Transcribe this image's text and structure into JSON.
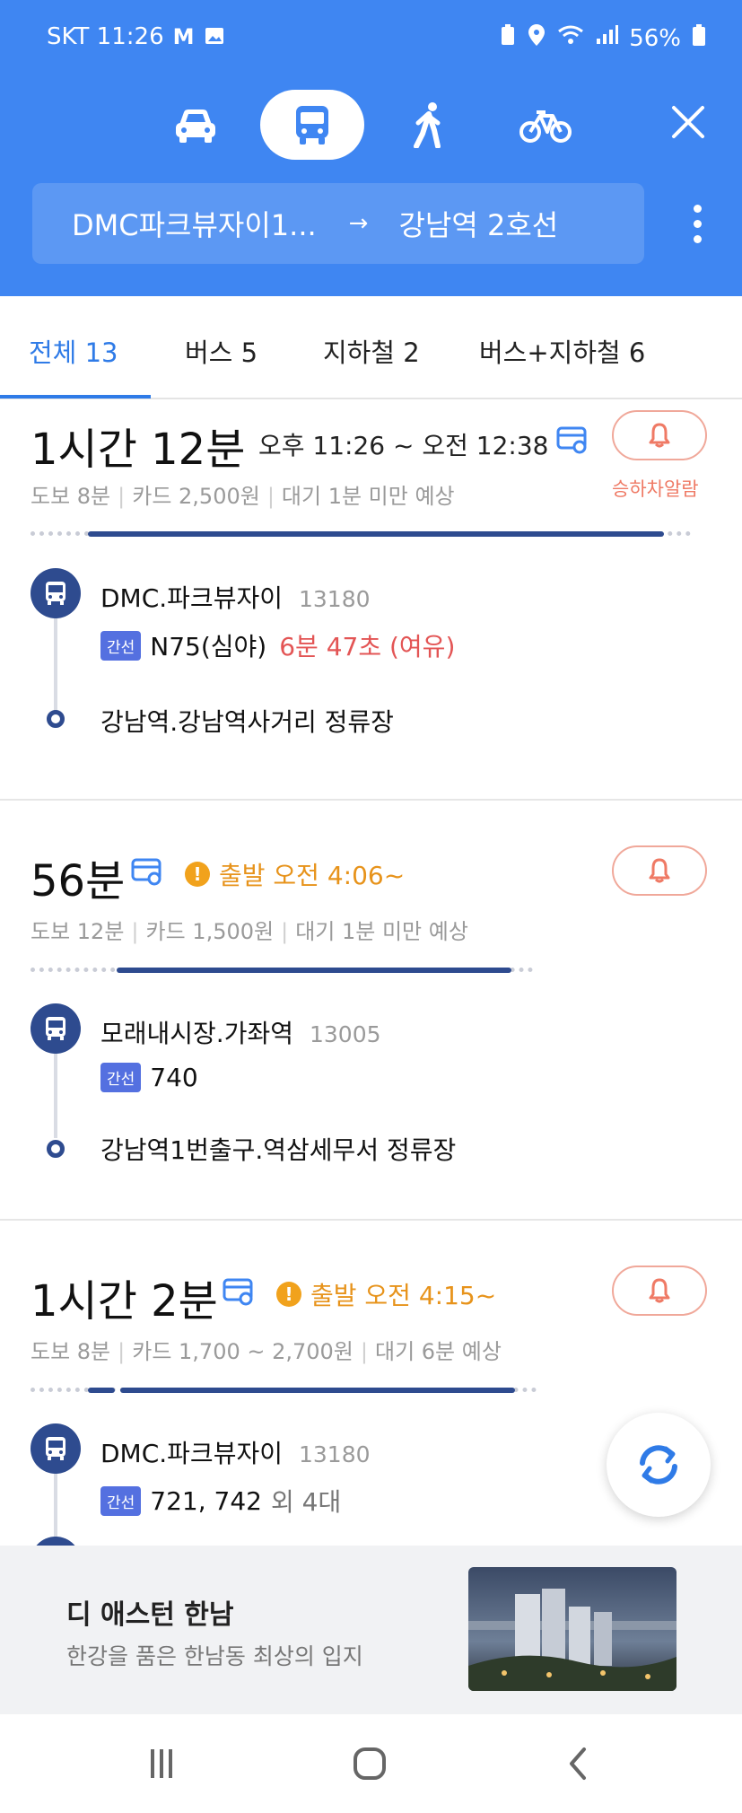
{
  "status_bar": {
    "carrier_time": "SKT 11:26",
    "battery": "56%"
  },
  "header": {
    "modes": [
      "car-icon",
      "bus-icon",
      "walk-icon",
      "bike-icon"
    ],
    "active_mode": "bus-icon",
    "route": {
      "from": "DMC파크뷰자이1...",
      "arrow": "→",
      "to": "강남역 2호선"
    }
  },
  "tabs": [
    {
      "label": "전체 13",
      "active": true
    },
    {
      "label": "버스 5",
      "active": false
    },
    {
      "label": "지하철 2",
      "active": false
    },
    {
      "label": "버스+지하철 6",
      "active": false
    }
  ],
  "routes": [
    {
      "total_time": "1시간 12분",
      "timespan": "오후 11:26 ~ 오전 12:38",
      "walk": "도보 8분",
      "fare": "카드 2,500원",
      "wait": "대기 1분 미만 예상",
      "alarm_label": "승하차알람",
      "progress": 0.91,
      "board_stop": "DMC.파크뷰자이",
      "board_stop_id": "13180",
      "line_badge": "간선",
      "line_name": "N75(심야)",
      "eta": "6분 47초 (여유)",
      "alight_stop": "강남역.강남역사거리 정류장"
    },
    {
      "total_time": "56분",
      "depart": "출발 오전 4:06~",
      "walk": "도보 12분",
      "fare": "카드 1,500원",
      "wait": "대기 1분 미만 예상",
      "progress": 0.79,
      "board_stop": "모래내시장.가좌역",
      "board_stop_id": "13005",
      "line_badge": "간선",
      "line_name": "740",
      "alight_stop": "강남역1번출구.역삼세무서 정류장"
    },
    {
      "total_time": "1시간 2분",
      "depart": "출발 오전 4:15~",
      "walk": "도보 8분",
      "fare": "카드 1,700 ~ 2,700원",
      "wait": "대기 6분 예상",
      "progress": 0.8,
      "board_stop": "DMC.파크뷰자이",
      "board_stop_id": "13180",
      "line_badge": "간선",
      "line_name": "721, 742",
      "line_extra": "외 4대"
    }
  ],
  "ad": {
    "title": "디 애스턴 한남",
    "subtitle": "한강을 품은 한남동 최상의 입지"
  },
  "colors": {
    "header": "#3f86f2",
    "accent": "#2f7be7",
    "route_line": "#2e4b8f",
    "warning": "#e7931b",
    "eta": "#e35555"
  }
}
